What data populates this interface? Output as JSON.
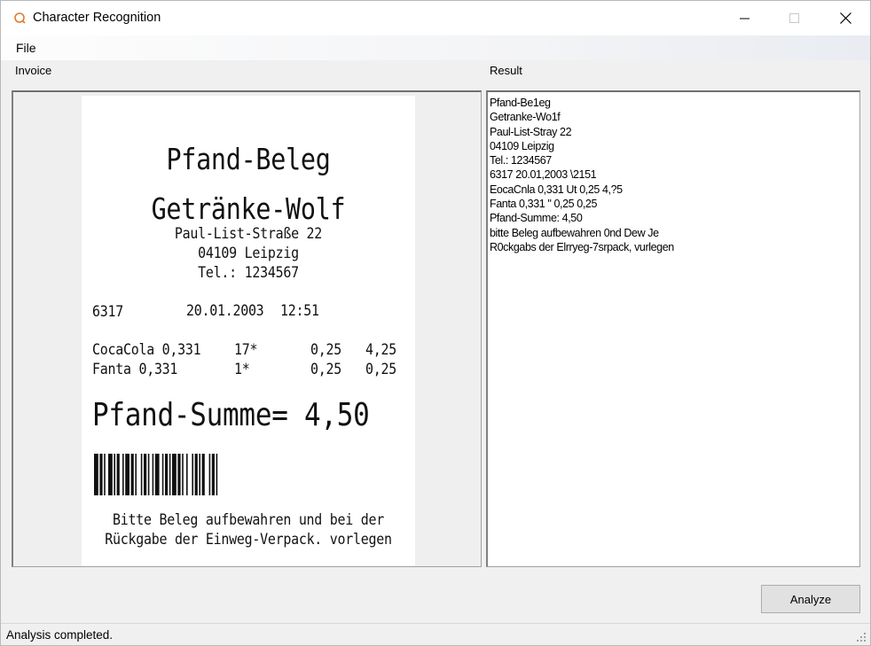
{
  "window": {
    "title": "Character Recognition",
    "icon": "ocr-app-icon",
    "controls": [
      "minimize-icon",
      "maximize-icon",
      "close-icon"
    ]
  },
  "menu": {
    "file": "File"
  },
  "invoice_label": "Invoice",
  "result_label": "Result",
  "receipt": {
    "title": "Pfand-Beleg",
    "shop": "Getränke-Wolf",
    "street": "Paul-List-Straße 22",
    "city": "04109 Leipzig",
    "phone": "Tel.: 1234567",
    "id": "6317",
    "date": "20.01.2003",
    "time": "12:51",
    "items": [
      {
        "name": "CocaCola 0,331",
        "qty": "17*",
        "price": "0,25",
        "total": "4,25"
      },
      {
        "name": "Fanta 0,331",
        "qty": "1*",
        "price": "0,25",
        "total": "0,25"
      }
    ],
    "sum": "Pfand-Summe= 4,50",
    "footer1": "Bitte Beleg aufbewahren und bei der",
    "footer2": "Rückgabe der Einweg-Verpack. vorlegen"
  },
  "result_lines": [
    "Pfand-Be1eg",
    "Getranke-Wo1f",
    "Paul-List-Stray 22",
    "04109 Leipzig",
    "Tel.: 1234567",
    "6317 20.01,2003 \\2151",
    "EocaCnla 0,331 Ut 0,25 4,?5",
    "Fanta 0,331 \" 0,25 0,25",
    "Pfand-Summe: 4,50",
    "bitte Beleg aufbewahren 0nd Dew Je",
    "R0ckgabs der Elrryeg-7srpack, vurlegen"
  ],
  "analyze_button": "Analyze",
  "status": "Analysis completed.",
  "colors": {
    "app_icon": "#e07a2e",
    "button_bg": "#e1e1e1",
    "window_bg": "#f0f0f0"
  }
}
